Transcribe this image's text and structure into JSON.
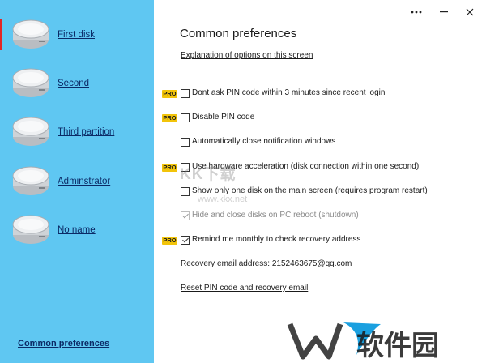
{
  "sidebar": {
    "disks": [
      {
        "label": "First disk",
        "active": true
      },
      {
        "label": "Second",
        "active": false
      },
      {
        "label": "Third partition",
        "active": false
      },
      {
        "label": "Adminstrator",
        "active": false
      },
      {
        "label": "No name",
        "active": false
      }
    ],
    "common_link": "Common preferences"
  },
  "window": {
    "menu_icon": "more-dots-icon",
    "minimize_icon": "minimize-icon",
    "close_icon": "close-icon"
  },
  "main": {
    "title": "Common preferences",
    "explain_link": "Explanation of options on this screen",
    "pro_badge": "PRO",
    "options": [
      {
        "label": "Dont ask PIN code within 3 minutes since recent login",
        "pro": true,
        "checked": false,
        "disabled": false
      },
      {
        "label": "Disable PIN code",
        "pro": true,
        "checked": false,
        "disabled": false
      },
      {
        "label": "Automatically close notification windows",
        "pro": false,
        "checked": false,
        "disabled": false
      },
      {
        "label": "Use hardware acceleration (disk connection within one second)",
        "pro": true,
        "checked": false,
        "disabled": false
      },
      {
        "label": "Show only one disk on the main screen (requires program restart)",
        "pro": false,
        "checked": false,
        "disabled": false
      },
      {
        "label": "Hide and close disks on PC reboot (shutdown)",
        "pro": false,
        "checked": true,
        "disabled": true
      },
      {
        "label": "Remind me monthly to check recovery address",
        "pro": true,
        "checked": true,
        "disabled": false
      }
    ],
    "recovery_text": "Recovery email address: 2152463675@qq.com",
    "reset_link": "Reset PIN code and recovery email"
  },
  "watermarks": {
    "center_text": "KK下载",
    "center_url": "www.kkx.net",
    "bottom_text": "软件园"
  },
  "colors": {
    "sidebar_bg": "#5fc7f2",
    "active_indicator": "#e32626",
    "pro_badge": "#f2c40a",
    "link_text": "#0b2a66"
  }
}
